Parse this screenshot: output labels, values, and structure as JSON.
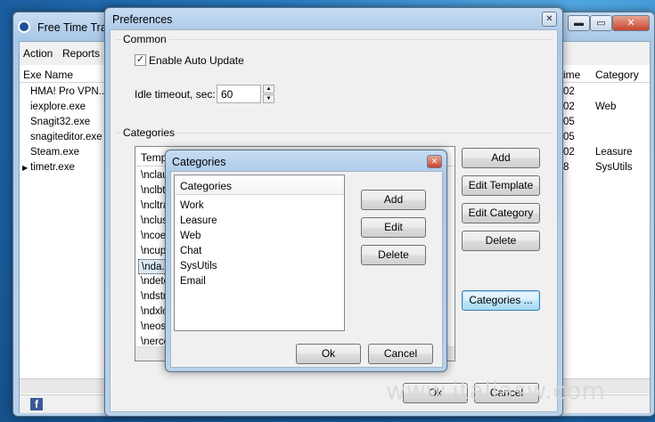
{
  "main": {
    "title": "Free Time Trac",
    "menu": [
      "Action",
      "Reports"
    ],
    "col_exe": "Exe Name",
    "col_time": "ime",
    "col_category": "Category",
    "rows": [
      {
        "exe": "HMA! Pro VPN...",
        "time": "02",
        "category": ""
      },
      {
        "exe": "iexplore.exe",
        "time": "02",
        "category": "Web"
      },
      {
        "exe": "Snagit32.exe",
        "time": "05",
        "category": ""
      },
      {
        "exe": "snagiteditor.exe",
        "time": "05",
        "category": ""
      },
      {
        "exe": "Steam.exe",
        "time": "02",
        "category": "Leasure"
      },
      {
        "exe": "timetr.exe",
        "time": "8",
        "category": "SysUtils"
      }
    ],
    "facebook_icon": "f"
  },
  "prefs": {
    "title": "Preferences",
    "close_glyph": "✕",
    "common_label": "Common",
    "auto_update_label": "Enable Auto Update",
    "auto_update_checked": true,
    "idle_label": "Idle timeout, sec:",
    "idle_value": "60",
    "categories_label": "Categories",
    "templ_header": "Templ",
    "templ_items": [
      "\\nclau",
      "\\nclbt",
      "\\ncltra",
      "\\nclus",
      "\\ncoe",
      "\\ncup",
      "\\nda.e",
      "\\ndete",
      "\\ndstr",
      "\\ndxlo",
      "\\neos",
      "\\nerce"
    ],
    "buttons": {
      "add": "Add",
      "edit_template": "Edit Template",
      "edit_category": "Edit Category",
      "delete": "Delete",
      "categories": "Categories ..."
    },
    "ok": "Ok",
    "cancel": "Cancel"
  },
  "cat": {
    "title": "Categories",
    "close_glyph": "✕",
    "list_header": "Categories",
    "items": [
      "Work",
      "Leasure",
      "Web",
      "Chat",
      "SysUtils",
      "Email"
    ],
    "add": "Add",
    "edit": "Edit",
    "delete": "Delete",
    "ok": "Ok",
    "cancel": "Cancel"
  },
  "watermark": "www.italiasw.com"
}
